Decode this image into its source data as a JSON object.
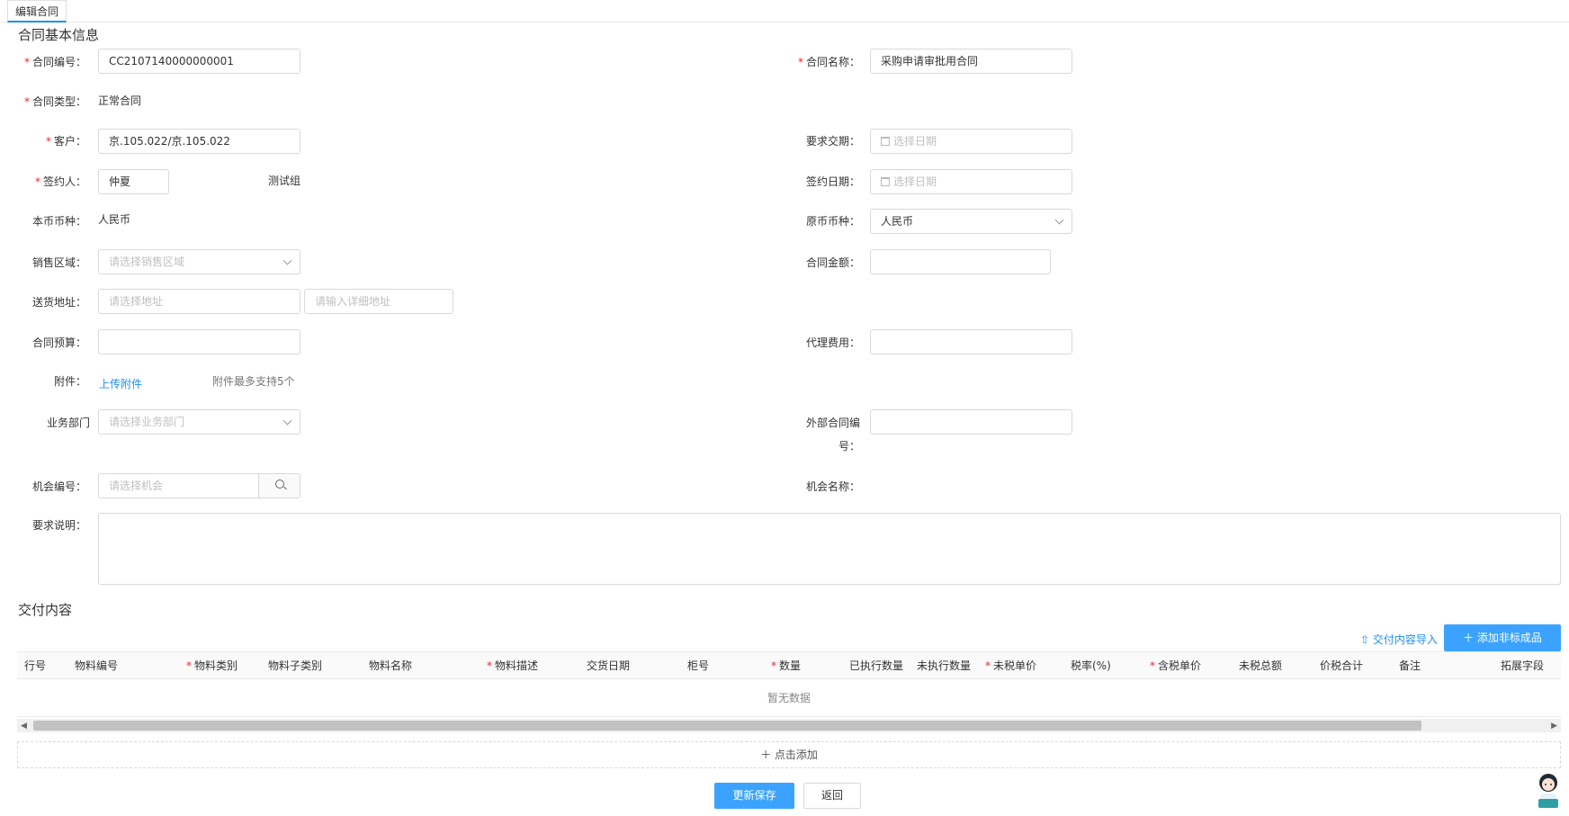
{
  "tab": {
    "label": "编辑合同"
  },
  "basic": {
    "title": "合同基本信息",
    "contract_no": {
      "label": "合同编号：",
      "value": "CC2107140000000001"
    },
    "contract_name": {
      "label": "合同名称：",
      "value": "采购申请审批用合同"
    },
    "contract_type": {
      "label": "合同类型：",
      "value": "正常合同"
    },
    "customer": {
      "label": "客户：",
      "value": "京.105.022/京.105.022"
    },
    "required_delivery": {
      "label": "要求交期：",
      "placeholder": "选择日期"
    },
    "signer": {
      "label": "签约人：",
      "value": "仲夏",
      "group": "测试组"
    },
    "sign_date": {
      "label": "签约日期：",
      "placeholder": "选择日期"
    },
    "local_currency": {
      "label": "本币币种：",
      "value": "人民币"
    },
    "orig_currency": {
      "label": "原币币种：",
      "value": "人民币"
    },
    "sales_region": {
      "label": "销售区域：",
      "placeholder": "请选择销售区域"
    },
    "contract_amount": {
      "label": "合同金额：",
      "value": ""
    },
    "delivery_address": {
      "label": "送货地址：",
      "placeholder": "请选择地址",
      "detail_placeholder": "请输入详细地址"
    },
    "budget": {
      "label": "合同预算：",
      "value": ""
    },
    "agency_fee": {
      "label": "代理费用：",
      "value": ""
    },
    "attachment": {
      "label": "附件：",
      "upload": "上传附件",
      "hint": "附件最多支持5个"
    },
    "department": {
      "label": "业务部门",
      "placeholder": "请选择业务部门"
    },
    "external_no": {
      "label_line1": "外部合同编",
      "label_line2": "号：",
      "value": ""
    },
    "opportunity_no": {
      "label": "机会编号：",
      "placeholder": "请选择机会"
    },
    "opportunity_name": {
      "label": "机会名称：",
      "value": ""
    },
    "requirement": {
      "label": "要求说明：",
      "value": ""
    }
  },
  "delivery": {
    "title": "交付内容",
    "import_label": "交付内容导入",
    "add_nonstd_label": "添加非标成品",
    "columns": [
      {
        "label": "行号",
        "required": false
      },
      {
        "label": "物料编号",
        "required": false
      },
      {
        "label": "物料类别",
        "required": true
      },
      {
        "label": "物料子类别",
        "required": false
      },
      {
        "label": "物料名称",
        "required": false
      },
      {
        "label": "物料描述",
        "required": true
      },
      {
        "label": "交货日期",
        "required": false
      },
      {
        "label": "柜号",
        "required": false
      },
      {
        "label": "数量",
        "required": true
      },
      {
        "label": "已执行数量",
        "required": false
      },
      {
        "label": "未执行数量",
        "required": false
      },
      {
        "label": "未税单价",
        "required": true
      },
      {
        "label": "税率(%)",
        "required": false
      },
      {
        "label": "含税单价",
        "required": true
      },
      {
        "label": "未税总额",
        "required": false
      },
      {
        "label": "价税合计",
        "required": false
      },
      {
        "label": "备注",
        "required": false
      },
      {
        "label": "拓展字段",
        "required": false
      }
    ],
    "empty_text": "暂无数据",
    "add_row_label": "点击添加"
  },
  "footer": {
    "save_label": "更新保存",
    "back_label": "返回"
  },
  "colors": {
    "primary": "#3ba3ff",
    "link": "#1890ff",
    "required": "#f5222d"
  }
}
